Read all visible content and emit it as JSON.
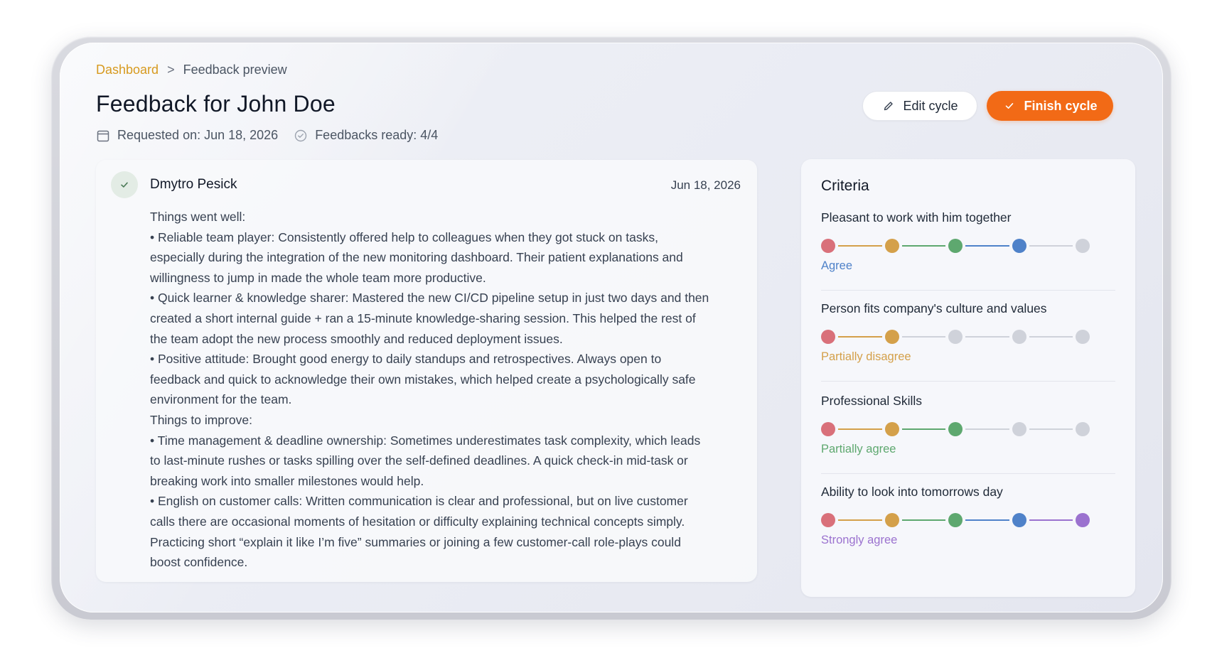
{
  "breadcrumb": {
    "root": "Dashboard",
    "separator": ">",
    "current": "Feedback preview"
  },
  "page": {
    "title": "Feedback for John Doe",
    "requested_on": "Requested on: Jun 18, 2026",
    "feedbacks_ready": "Feedbacks ready: 4/4"
  },
  "actions": {
    "edit_label": "Edit cycle",
    "finish_label": "Finish cycle"
  },
  "feedback": {
    "author": "Dmytro Pesick",
    "date": "Jun 18, 2026",
    "lines": [
      "Things went well:",
      "• Reliable team player: Consistently offered help to colleagues when they got stuck on tasks,",
      "especially during the integration of the new monitoring dashboard. Their patient explanations and",
      "willingness to jump in made the whole team more productive.",
      "• Quick learner & knowledge sharer: Mastered the new CI/CD pipeline setup in just two days and then",
      "created a short internal guide + ran a 15-minute knowledge-sharing session. This helped the rest of",
      "the team adopt the new process smoothly and reduced deployment issues.",
      "• Positive attitude: Brought good energy to daily standups and retrospectives. Always open to",
      "feedback and quick to acknowledge their own mistakes, which helped create a psychologically safe",
      "environment for the team.",
      "Things to improve:",
      "• Time management & deadline ownership: Sometimes underestimates task complexity, which leads",
      "to last-minute rushes or tasks spilling over the self-defined deadlines. A quick check-in mid-task or",
      "breaking work into smaller milestones would help.",
      "• English on customer calls: Written communication is clear and professional, but on live customer",
      "calls there are occasional moments of hesitation or difficulty explaining technical concepts simply.",
      "Practicing short “explain it like I’m five” summaries or joining a few customer-call role-plays could",
      "boost confidence."
    ]
  },
  "criteria": {
    "title": "Criteria",
    "scale_colors": [
      "#d9707a",
      "#d4a04a",
      "#5ea86f",
      "#4f82c9",
      "#9b72cf"
    ],
    "inactive_color": "#cfd2da",
    "items": [
      {
        "label": "Pleasant to work with him together",
        "value": "Agree",
        "level": 4,
        "value_color": "#4f82c9"
      },
      {
        "label": "Person fits company's culture and values",
        "value": "Partially disagree",
        "level": 2,
        "value_color": "#d4a04a"
      },
      {
        "label": "Professional Skills",
        "value": "Partially agree",
        "level": 3,
        "value_color": "#5ea86f"
      },
      {
        "label": "Ability to look into tomorrows day",
        "value": "Strongly agree",
        "level": 5,
        "value_color": "#9b72cf"
      }
    ]
  }
}
